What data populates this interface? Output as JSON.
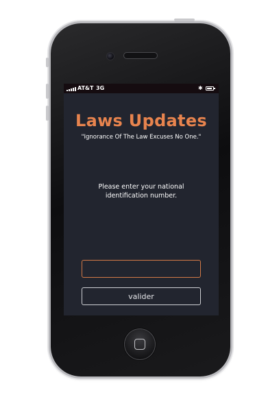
{
  "status_bar": {
    "carrier": "AT&T",
    "network": "3G",
    "bluetooth_icon": "bluetooth-icon",
    "battery_level": 0.85
  },
  "app": {
    "title": "Laws Updates",
    "motto": "\"Ignorance Of The Law Excuses No One.\"",
    "prompt": "Please enter your national identification number.",
    "id_input": {
      "value": "",
      "placeholder": ""
    },
    "validate_label": "valider"
  },
  "colors": {
    "accent": "#e8844e",
    "screen_background": "#22252f",
    "input_border": "#d47a47"
  }
}
